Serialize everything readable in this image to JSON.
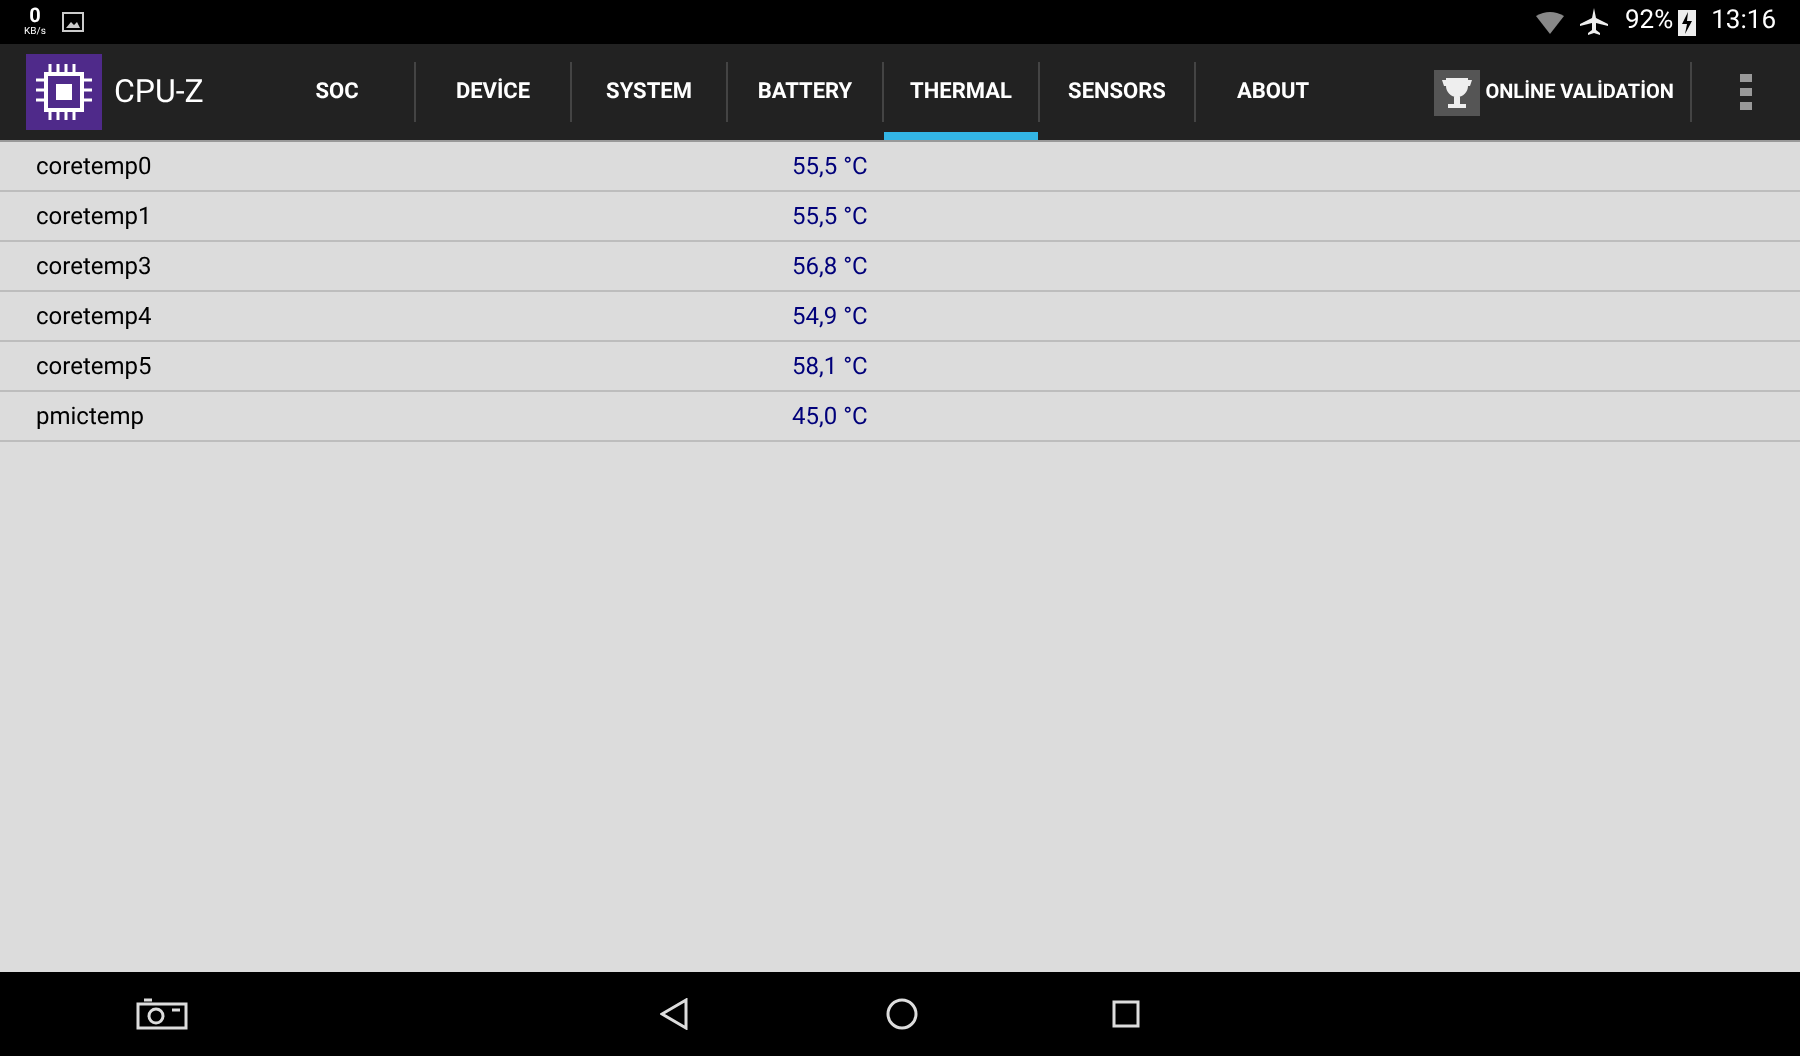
{
  "status_bar": {
    "net_speed": "0",
    "net_unit": "KB/s",
    "battery": "92%",
    "time": "13:16"
  },
  "app": {
    "title": "CPU-Z"
  },
  "tabs": [
    {
      "label": "SOC",
      "selected": false
    },
    {
      "label": "DEVİCE",
      "selected": false
    },
    {
      "label": "SYSTEM",
      "selected": false
    },
    {
      "label": "BATTERY",
      "selected": false
    },
    {
      "label": "THERMAL",
      "selected": true
    },
    {
      "label": "SENSORS",
      "selected": false
    },
    {
      "label": "ABOUT",
      "selected": false
    }
  ],
  "validation_button": "ONLİNE VALİDATİON",
  "rows": [
    {
      "name": "coretemp0",
      "value": "55,5 °C"
    },
    {
      "name": "coretemp1",
      "value": "55,5 °C"
    },
    {
      "name": "coretemp3",
      "value": "56,8 °C"
    },
    {
      "name": "coretemp4",
      "value": "54,9 °C"
    },
    {
      "name": "coretemp5",
      "value": "58,1 °C"
    },
    {
      "name": "pmictemp",
      "value": "45,0 °C"
    }
  ]
}
